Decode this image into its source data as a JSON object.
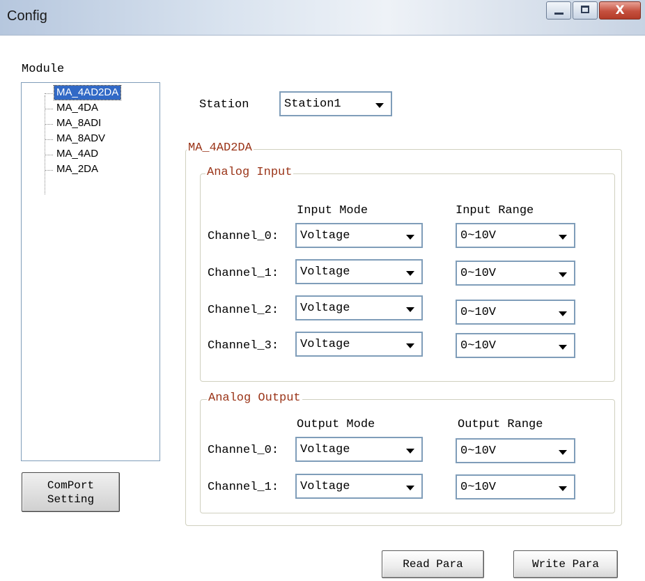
{
  "window": {
    "title": "Config",
    "close_glyph": "X",
    "icons": [
      "minimize-icon",
      "maximize-icon",
      "close-icon"
    ]
  },
  "module": {
    "label": "Module",
    "items": [
      "MA_4AD2DA",
      "MA_4DA",
      "MA_8ADI",
      "MA_8ADV",
      "MA_4AD",
      "MA_2DA"
    ],
    "selected": "MA_4AD2DA"
  },
  "comport_button": "ComPort\nSetting",
  "station": {
    "label": "Station",
    "value": "Station1"
  },
  "module_group": {
    "title": "MA_4AD2DA"
  },
  "analog_input": {
    "title": "Analog Input",
    "mode_header": "Input Mode",
    "range_header": "Input Range",
    "channels": [
      {
        "label": "Channel_0:",
        "mode": "Voltage",
        "range": "0~10V"
      },
      {
        "label": "Channel_1:",
        "mode": "Voltage",
        "range": "0~10V"
      },
      {
        "label": "Channel_2:",
        "mode": "Voltage",
        "range": "0~10V"
      },
      {
        "label": "Channel_3:",
        "mode": "Voltage",
        "range": "0~10V"
      }
    ]
  },
  "analog_output": {
    "title": "Analog Output",
    "mode_header": "Output Mode",
    "range_header": "Output Range",
    "channels": [
      {
        "label": "Channel_0:",
        "mode": "Voltage",
        "range": "0~10V"
      },
      {
        "label": "Channel_1:",
        "mode": "Voltage",
        "range": "0~10V"
      }
    ]
  },
  "buttons": {
    "read": "Read Para",
    "write": "Write Para"
  },
  "colors": {
    "group_title": "#9a3418",
    "selection": "#3169c6",
    "combo_border": "#7f9db9"
  }
}
